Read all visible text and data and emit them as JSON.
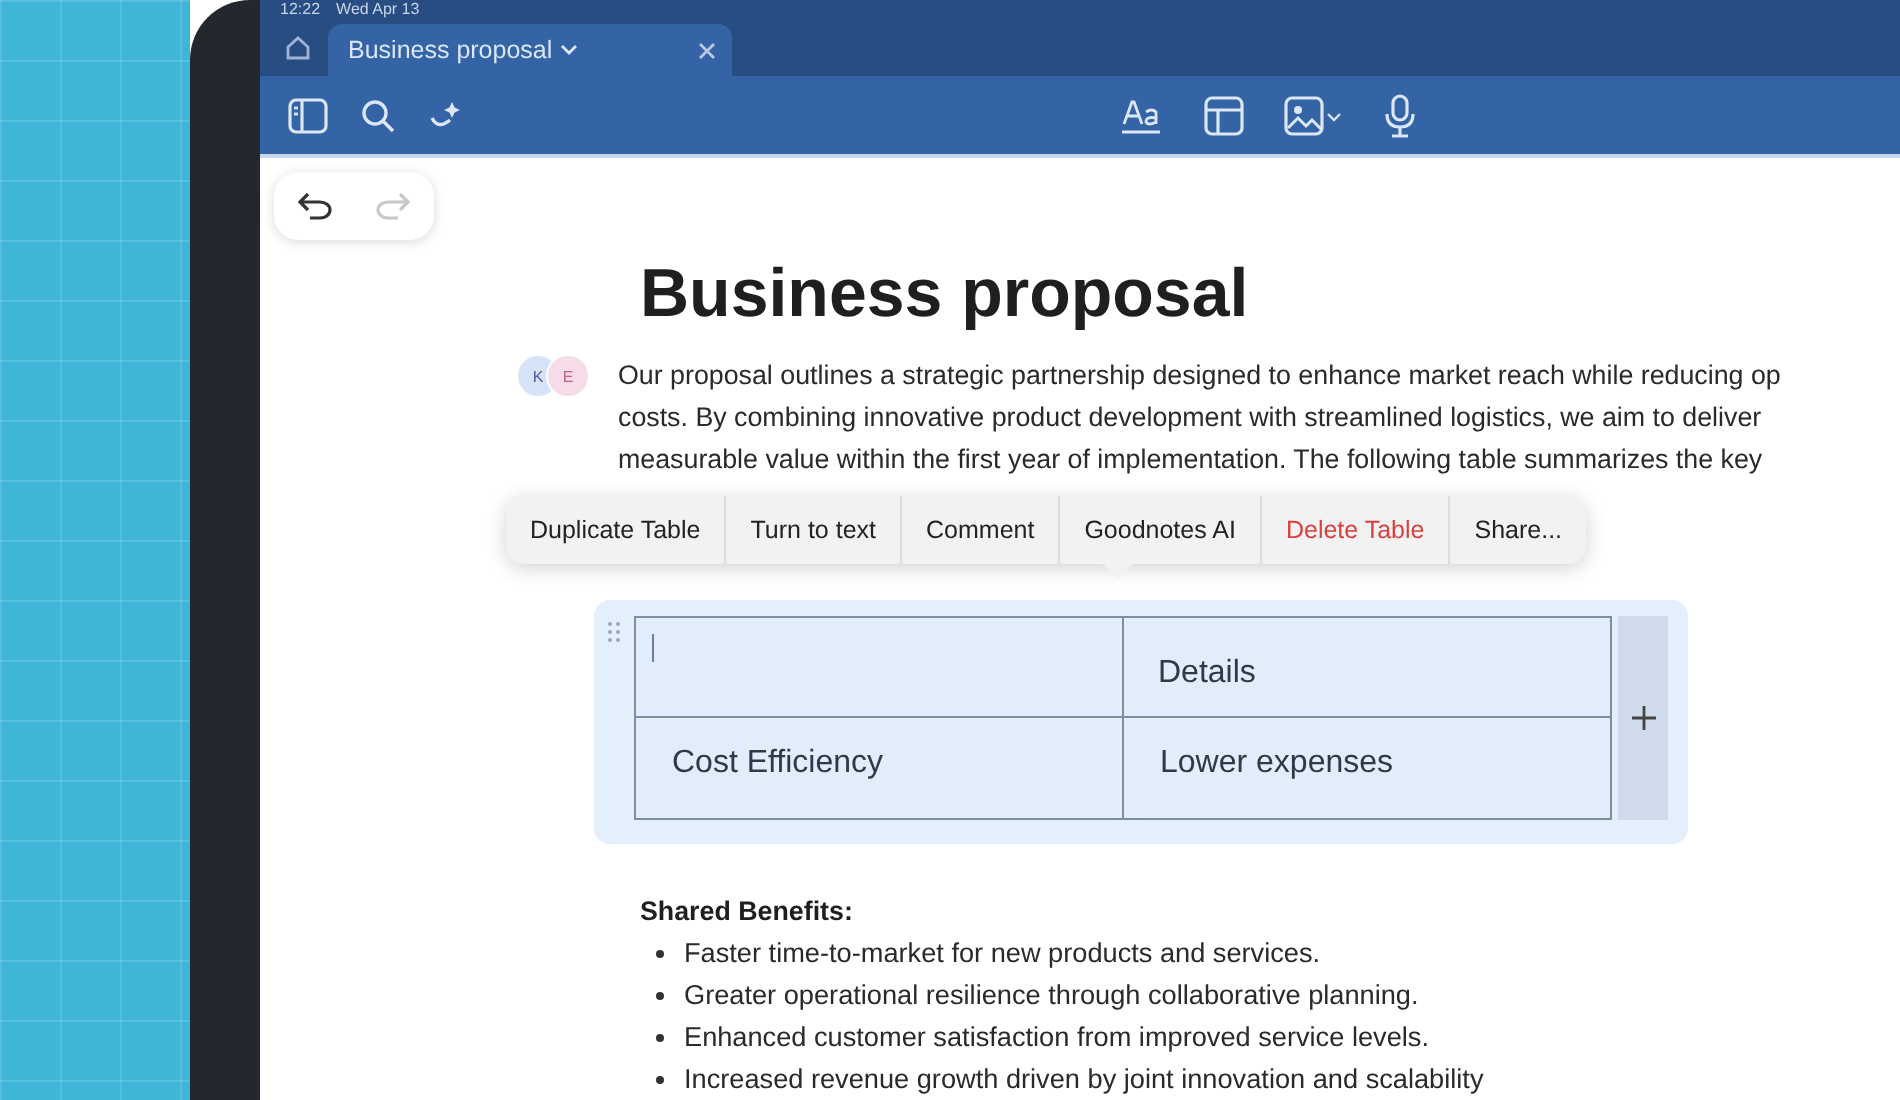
{
  "status_bar": {
    "time": "12:22",
    "date": "Wed Apr 13"
  },
  "tabs": [
    {
      "label": "Business proposal",
      "selected": true
    }
  ],
  "document": {
    "title": "Business proposal",
    "collaborators": [
      {
        "initial": "K",
        "color": "#d6e3f8"
      },
      {
        "initial": "E",
        "color": "#f6dbe8"
      }
    ],
    "paragraph_lines": [
      "Our proposal outlines a strategic partnership designed to enhance market reach while reducing op",
      "costs. By combining innovative product development with streamlined logistics, we aim to deliver",
      "measurable value within the first year of implementation. The following table summarizes the key"
    ],
    "context_menu": [
      {
        "label": "Duplicate Table",
        "kind": "normal"
      },
      {
        "label": "Turn to text",
        "kind": "normal"
      },
      {
        "label": "Comment",
        "kind": "normal"
      },
      {
        "label": "Goodnotes AI",
        "kind": "normal"
      },
      {
        "label": "Delete Table",
        "kind": "destructive"
      },
      {
        "label": "Share...",
        "kind": "normal"
      }
    ],
    "table": {
      "rows": [
        [
          "",
          "Details"
        ],
        [
          "Cost Efficiency",
          "Lower expenses"
        ]
      ]
    },
    "section_heading": "Shared Benefits:",
    "bullets": [
      "Faster time-to-market for new products and services.",
      "Greater operational resilience through collaborative planning.",
      "Enhanced customer satisfaction from improved service levels.",
      "Increased revenue growth driven by joint innovation and scalability"
    ]
  }
}
